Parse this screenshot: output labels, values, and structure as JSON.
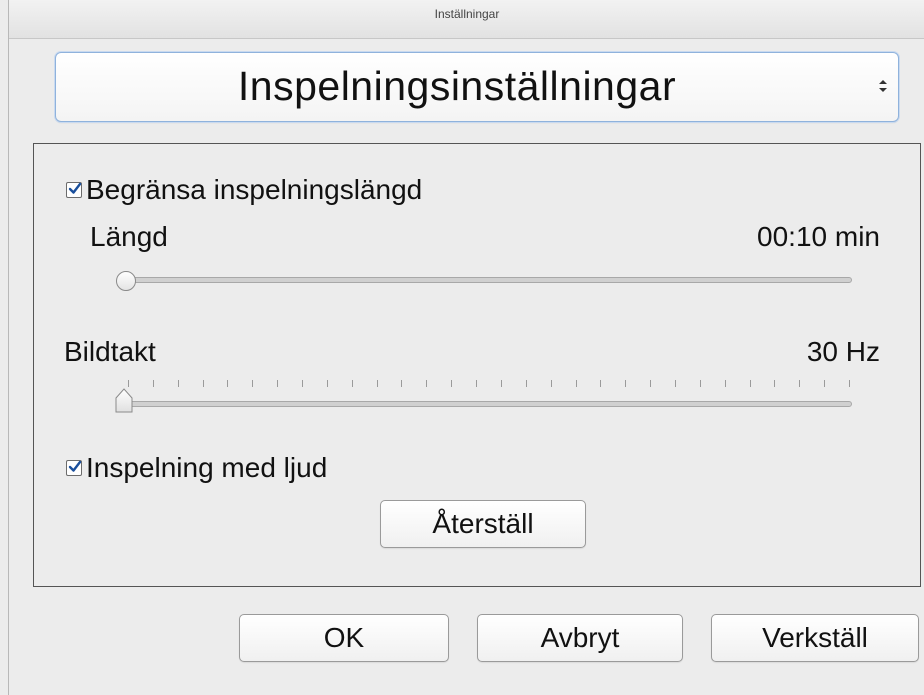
{
  "window": {
    "title": "Inställningar"
  },
  "settings_popup": {
    "selected": "Inspelningsinställningar"
  },
  "recording": {
    "limit_checkbox": {
      "label": "Begränsa inspelningslängd",
      "checked": true
    },
    "length": {
      "label": "Längd",
      "value": "00:10 min",
      "slider_position": 0
    },
    "framerate": {
      "label": "Bildtakt",
      "value": "30 Hz",
      "slider_position": 0
    },
    "audio_checkbox": {
      "label": "Inspelning med ljud",
      "checked": true
    },
    "reset_label": "Återställ"
  },
  "footer": {
    "ok_label": "OK",
    "cancel_label": "Avbryt",
    "apply_label": "Verkställ"
  }
}
